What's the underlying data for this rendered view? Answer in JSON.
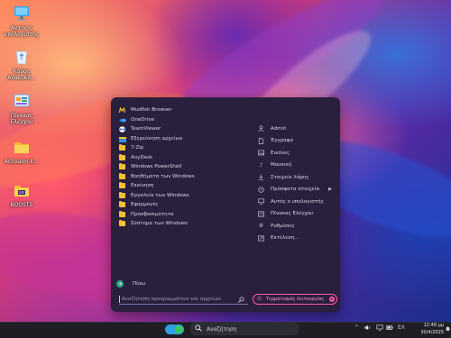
{
  "desktop": {
    "icons": [
      {
        "label": "Αυτός ο υπολογιστής",
        "icon": "computer-icon"
      },
      {
        "label": "Κάδος Ανακυκλ...",
        "icon": "recycle-bin-icon"
      },
      {
        "label": "Πίνακας Ελέγχου",
        "icon": "control-panel-icon"
      },
      {
        "label": "Activator-E...",
        "icon": "folder-icon"
      },
      {
        "label": "BOOSTS",
        "icon": "boosts-folder-icon"
      }
    ]
  },
  "start_menu": {
    "apps": [
      {
        "label": "Mudfish Browser",
        "icon": "mudfish-icon"
      },
      {
        "label": "OneDrive",
        "icon": "onedrive-icon"
      },
      {
        "label": "TeamViewer",
        "icon": "teamviewer-icon"
      },
      {
        "label": "Εξερεύνηση αρχείων",
        "icon": "file-explorer-icon"
      },
      {
        "label": "7-Zip",
        "icon": "folder-icon"
      },
      {
        "label": "AnyDesk",
        "icon": "folder-icon"
      },
      {
        "label": "Windows PowerShell",
        "icon": "folder-icon"
      },
      {
        "label": "Βοηθήματα των Windows",
        "icon": "folder-icon"
      },
      {
        "label": "Εκκίνηση",
        "icon": "folder-icon"
      },
      {
        "label": "Εργαλεία των Windows",
        "icon": "folder-icon"
      },
      {
        "label": "Εφαρμογές",
        "icon": "folder-icon"
      },
      {
        "label": "Προσβασιμότητα",
        "icon": "folder-icon"
      },
      {
        "label": "Σύστημα των Windows",
        "icon": "folder-icon"
      }
    ],
    "places": [
      {
        "label": "Admin",
        "icon": "user-icon"
      },
      {
        "label": "Έγγραφα",
        "icon": "document-icon"
      },
      {
        "label": "Εικόνες",
        "icon": "pictures-icon"
      },
      {
        "label": "Μουσική",
        "icon": "music-icon"
      },
      {
        "label": "Στοιχεία λήψης",
        "icon": "download-icon"
      },
      {
        "label": "Πρόσφατα στοιχεία",
        "icon": "recent-icon",
        "submenu": true
      },
      {
        "label": "Αυτός ο υπολογιστής",
        "icon": "computer-icon"
      },
      {
        "label": "Πίνακας Ελέγχου",
        "icon": "control-panel-icon"
      },
      {
        "label": "Ρυθμίσεις",
        "icon": "settings-icon"
      },
      {
        "label": "Εκτέλεση...",
        "icon": "run-icon"
      }
    ],
    "back_label": "Πίσω",
    "search_placeholder": "Αναζήτηση προγραμμάτων και αρχείων",
    "shutdown_label": "Τερματισμός λειτουργίας"
  },
  "taskbar": {
    "search_label": "Αναζήτηση",
    "language": "ΕΛ",
    "time": "12:48 μμ",
    "date": "30/4/2025"
  }
}
